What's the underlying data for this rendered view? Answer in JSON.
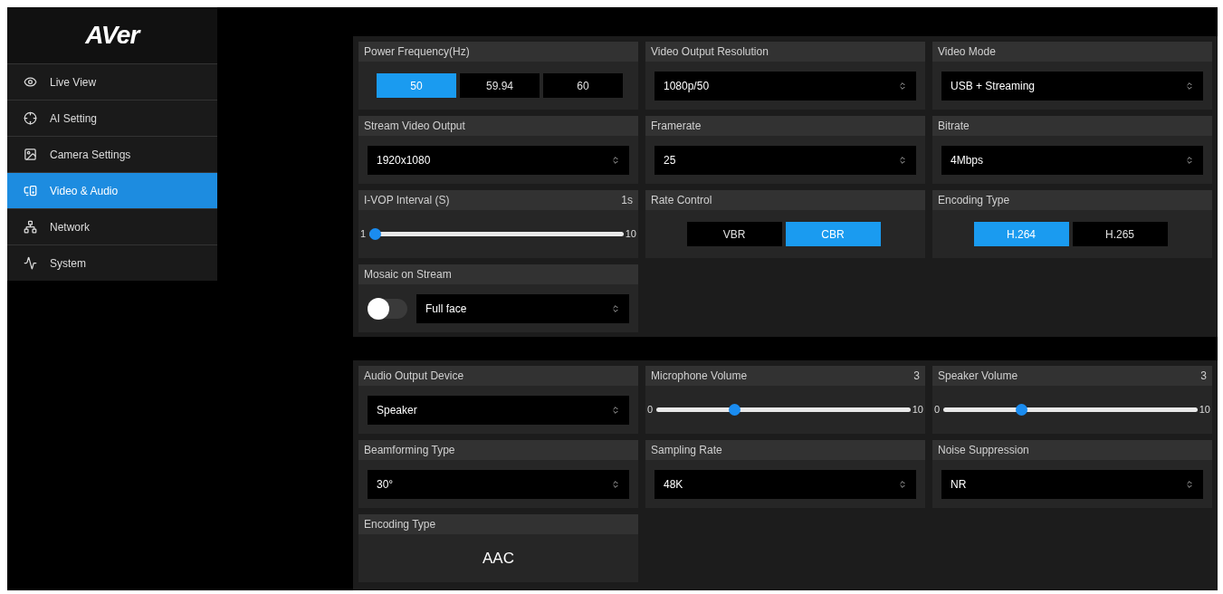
{
  "sidebar": {
    "logo": "AVer",
    "items": [
      {
        "label": "Live View",
        "selected": false
      },
      {
        "label": "AI Setting",
        "selected": false
      },
      {
        "label": "Camera Settings",
        "selected": false
      },
      {
        "label": "Video & Audio",
        "selected": true
      },
      {
        "label": "Network",
        "selected": false
      },
      {
        "label": "System",
        "selected": false
      }
    ]
  },
  "sections": [
    {
      "cells": [
        {
          "kind": "segmented",
          "label": "Power Frequency(Hz)",
          "options": [
            {
              "label": "50",
              "selected": true
            },
            {
              "label": "59.94",
              "selected": false
            },
            {
              "label": "60",
              "selected": false
            }
          ]
        },
        {
          "kind": "select",
          "label": "Video Output Resolution",
          "value": "1080p/50"
        },
        {
          "kind": "select",
          "label": "Video Mode",
          "value": "USB + Streaming"
        },
        {
          "kind": "select",
          "label": "Stream Video Output",
          "value": "1920x1080"
        },
        {
          "kind": "select",
          "label": "Framerate",
          "value": "25"
        },
        {
          "kind": "select",
          "label": "Bitrate",
          "value": "4Mbps"
        },
        {
          "kind": "slider",
          "label": "I-VOP Interval (S)",
          "reading": "1s",
          "min": "1",
          "max": "10",
          "level": 0
        },
        {
          "kind": "segmented",
          "label": "Rate Control",
          "options": [
            {
              "label": "VBR",
              "selected": false
            },
            {
              "label": "CBR",
              "selected": true
            }
          ]
        },
        {
          "kind": "segmented",
          "label": "Encoding Type",
          "options": [
            {
              "label": "H.264",
              "selected": true
            },
            {
              "label": "H.265",
              "selected": false
            }
          ]
        },
        {
          "kind": "toggle_select",
          "label": "Mosaic on Stream",
          "on": false,
          "value": "Full face"
        }
      ]
    },
    {
      "cells": [
        {
          "kind": "select",
          "label": "Audio Output Device",
          "value": "Speaker"
        },
        {
          "kind": "slider",
          "label": "Microphone Volume",
          "reading": "3",
          "min": "0",
          "max": "10",
          "level": 0.3
        },
        {
          "kind": "slider",
          "label": "Speaker Volume",
          "reading": "3",
          "min": "0",
          "max": "10",
          "level": 0.3
        },
        {
          "kind": "select",
          "label": "Beamforming Type",
          "value": "30°"
        },
        {
          "kind": "select",
          "label": "Sampling Rate",
          "value": "48K"
        },
        {
          "kind": "select",
          "label": "Noise Suppression",
          "value": "NR"
        },
        {
          "kind": "static",
          "label": "Encoding Type",
          "value": "AAC"
        }
      ]
    }
  ]
}
